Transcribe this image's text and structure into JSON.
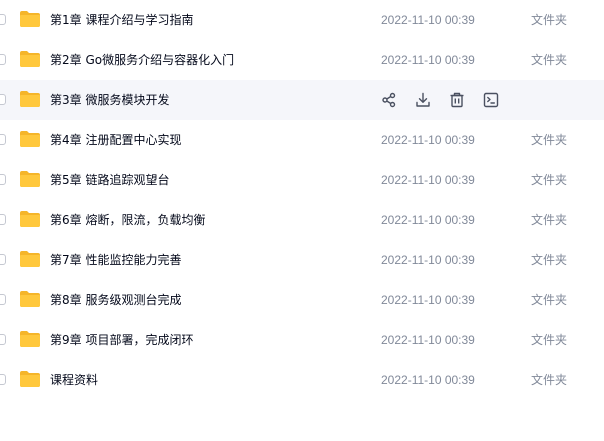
{
  "files": [
    {
      "name": "第1章 课程介绍与学习指南",
      "date": "2022-11-10 00:39",
      "type": "文件夹"
    },
    {
      "name": "第2章 Go微服务介绍与容器化入门",
      "date": "2022-11-10 00:39",
      "type": "文件夹"
    },
    {
      "name": "第3章 微服务模块开发",
      "date": "",
      "type": ""
    },
    {
      "name": "第4章 注册配置中心实现",
      "date": "2022-11-10 00:39",
      "type": "文件夹"
    },
    {
      "name": "第5章 链路追踪观望台",
      "date": "2022-11-10 00:39",
      "type": "文件夹"
    },
    {
      "name": "第6章 熔断，限流，负载均衡",
      "date": "2022-11-10 00:39",
      "type": "文件夹"
    },
    {
      "name": "第7章 性能监控能力完善",
      "date": "2022-11-10 00:39",
      "type": "文件夹"
    },
    {
      "name": "第8章 服务级观测台完成",
      "date": "2022-11-10 00:39",
      "type": "文件夹"
    },
    {
      "name": "第9章 项目部署，完成闭环",
      "date": "2022-11-10 00:39",
      "type": "文件夹"
    },
    {
      "name": "课程资料",
      "date": "2022-11-10 00:39",
      "type": "文件夹"
    }
  ],
  "hovered_row_actions": [
    "share-icon",
    "download-icon",
    "delete-icon",
    "terminal-icon"
  ],
  "colors": {
    "folder": "#ffc83d",
    "folder_tab": "#f5b52a",
    "hover_bg": "#f5f6fa",
    "secondary_text": "#818999",
    "primary_text": "#03081a",
    "action_icon": "#4a5060"
  }
}
